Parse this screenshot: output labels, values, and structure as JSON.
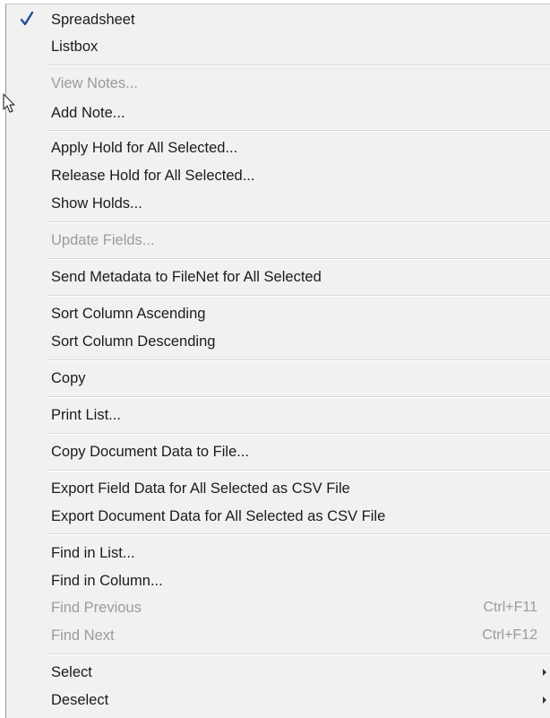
{
  "menu": {
    "items": [
      {
        "label": "Spreadsheet",
        "checked": true
      },
      {
        "label": "Listbox"
      },
      {
        "label": "View Notes...",
        "disabled": true
      },
      {
        "label": "Add Note..."
      },
      {
        "label": "Apply Hold for All Selected..."
      },
      {
        "label": "Release Hold for All Selected..."
      },
      {
        "label": "Show Holds..."
      },
      {
        "label": "Update Fields...",
        "disabled": true
      },
      {
        "label": "Send Metadata to FileNet for All Selected"
      },
      {
        "label": "Sort Column Ascending"
      },
      {
        "label": "Sort Column Descending"
      },
      {
        "label": "Copy"
      },
      {
        "label": "Print List..."
      },
      {
        "label": "Copy Document Data to File..."
      },
      {
        "label": "Export Field Data for All Selected as CSV File"
      },
      {
        "label": "Export Document Data for All Selected as CSV File"
      },
      {
        "label": "Find in List..."
      },
      {
        "label": "Find in Column..."
      },
      {
        "label": "Find Previous",
        "shortcut": "Ctrl+F11",
        "disabled": true
      },
      {
        "label": "Find Next",
        "shortcut": "Ctrl+F12",
        "disabled": true
      },
      {
        "label": "Select",
        "submenu": true
      },
      {
        "label": "Deselect",
        "submenu": true
      }
    ]
  },
  "icons": {
    "check": "checkmark-icon",
    "submenu": "submenu-arrow-icon",
    "cursor": "mouse-pointer-icon"
  },
  "colors": {
    "menu_background": "#f1f1f1",
    "text": "#1b1b1b",
    "disabled_text": "#9b9b9b",
    "check": "#1f4e9c"
  }
}
